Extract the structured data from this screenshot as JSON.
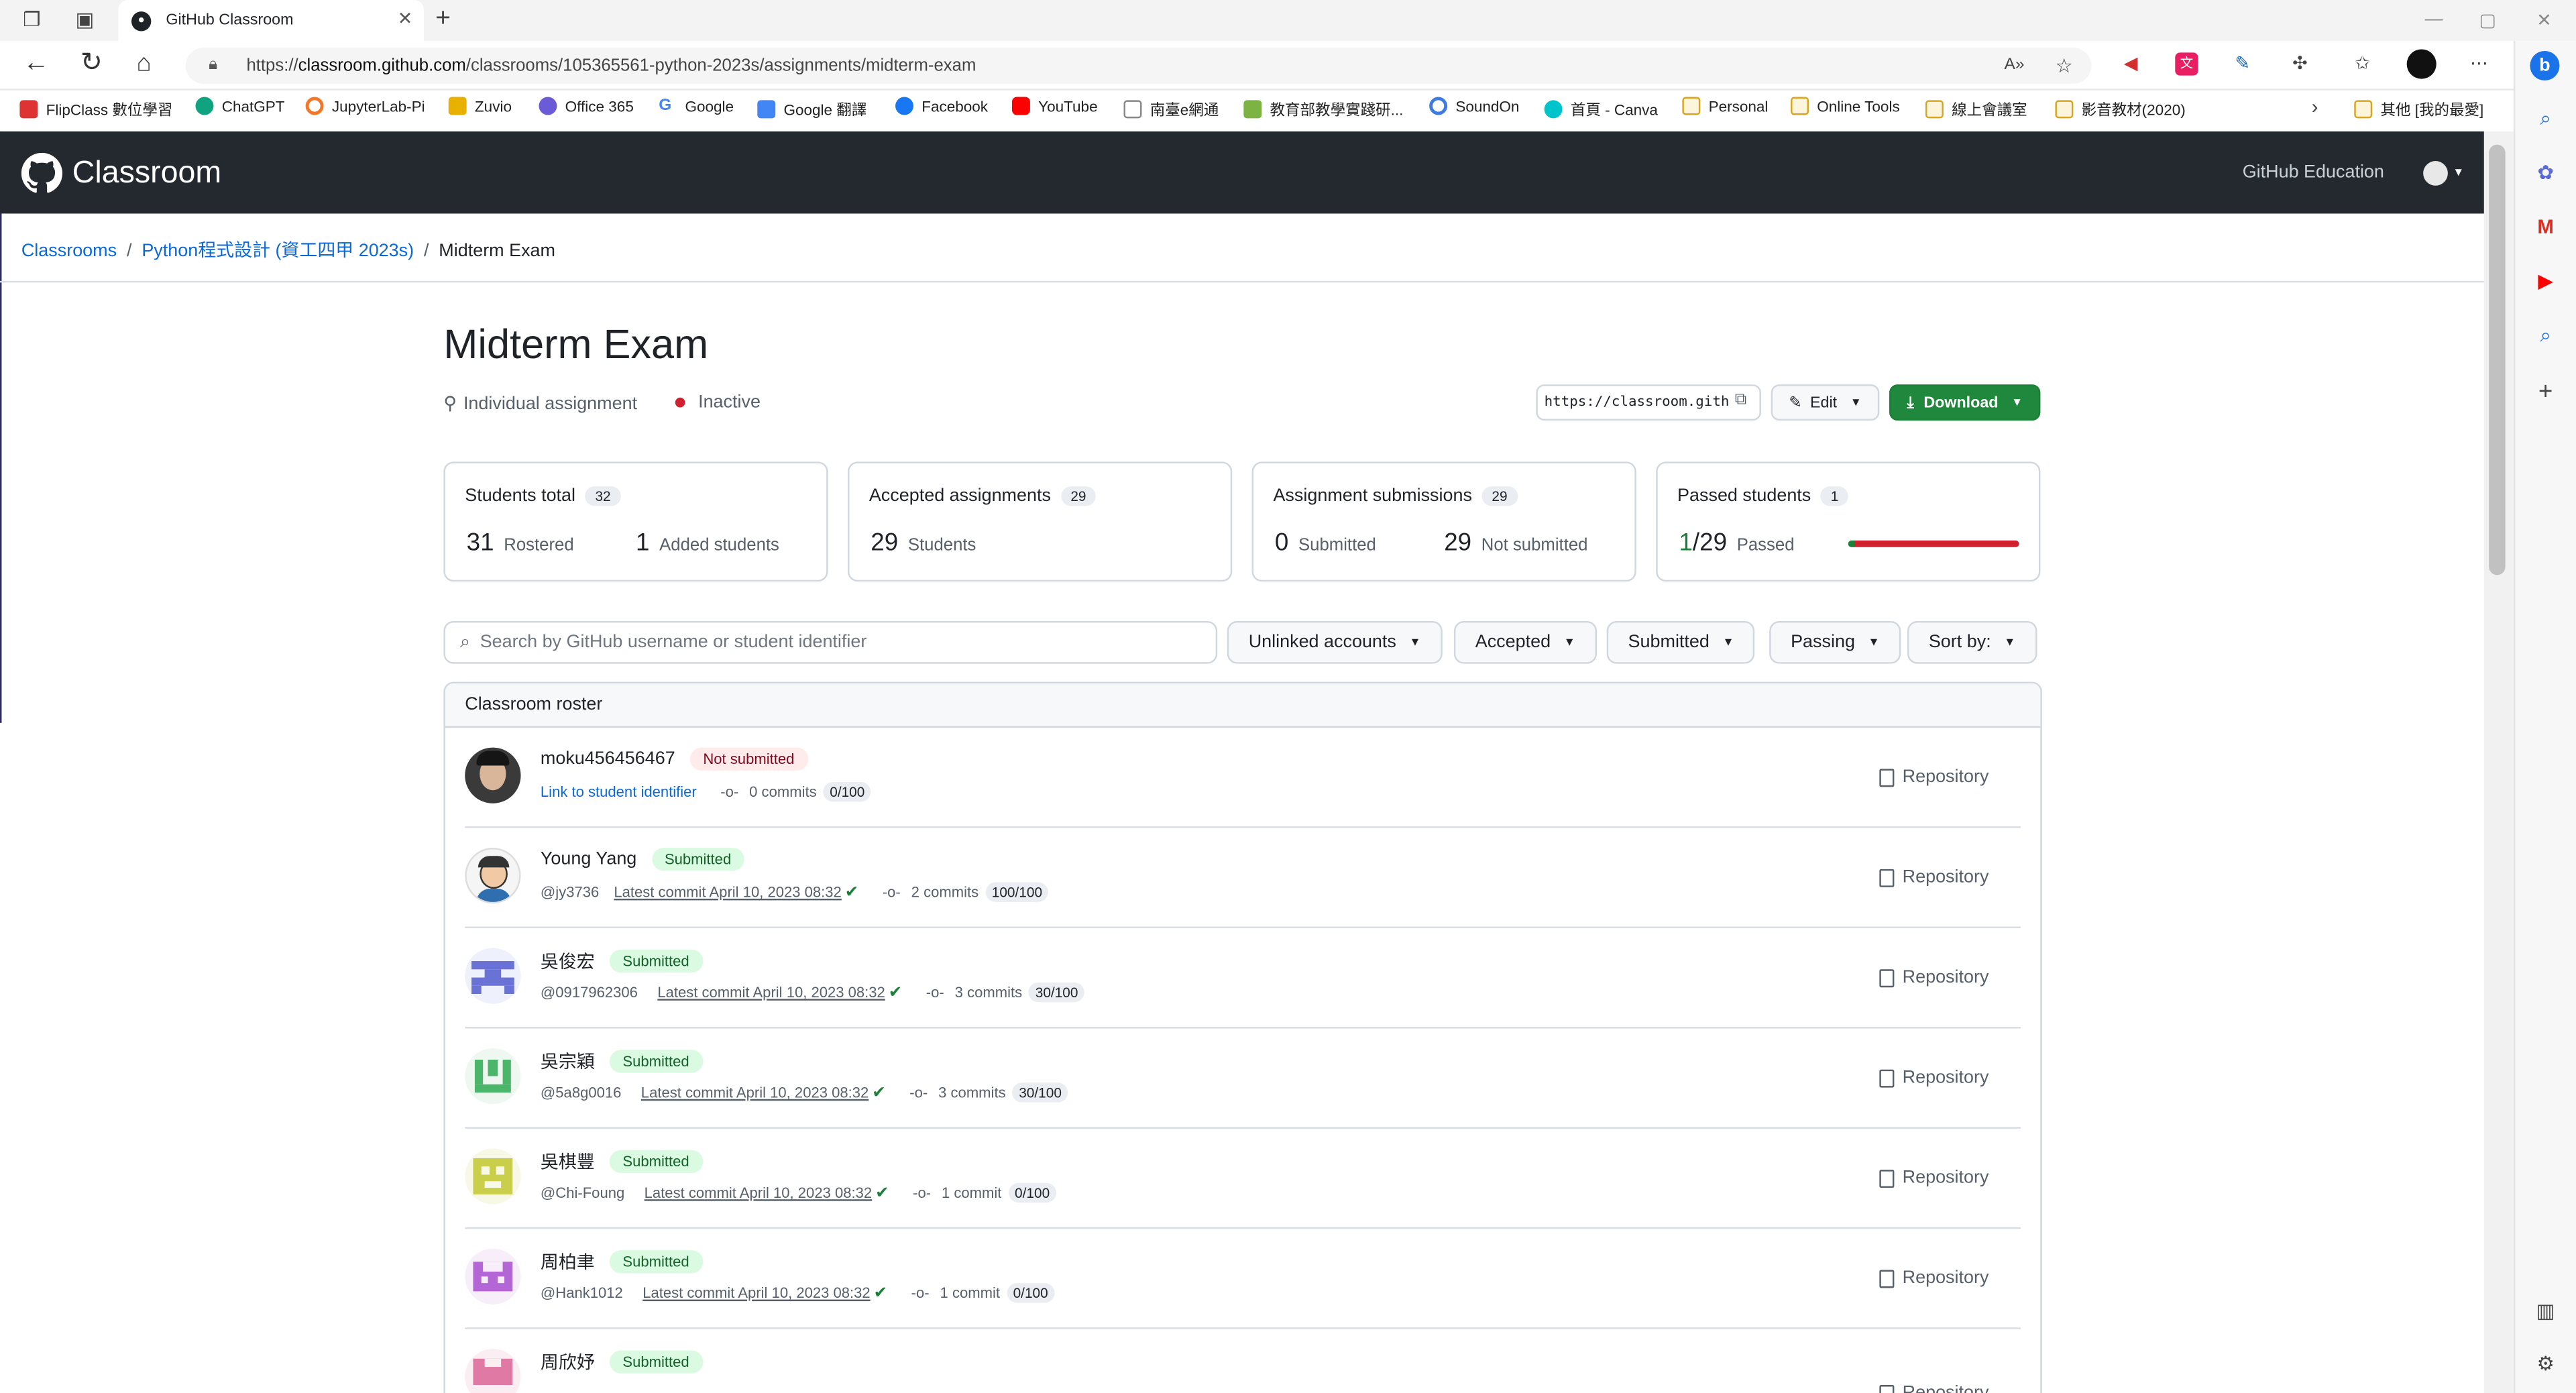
{
  "browser": {
    "tab_title": "GitHub Classroom",
    "url_prefix": "https://",
    "url_host": "classroom.github.com",
    "url_path": "/classrooms/105365561-python-2023s/assignments/midterm-exam"
  },
  "bookmarks": [
    {
      "label": "FlipClass 數位學習",
      "icon": "flipclass-icon",
      "color": "#d33"
    },
    {
      "label": "ChatGPT",
      "icon": "chatgpt-icon",
      "color": "#10a37f"
    },
    {
      "label": "JupyterLab-Pi",
      "icon": "jupyter-icon",
      "color": "#f37726"
    },
    {
      "label": "Zuvio",
      "icon": "zuvio-icon",
      "color": "#e8b000"
    },
    {
      "label": "Office 365",
      "icon": "office-icon",
      "color": "#6b5bd6"
    },
    {
      "label": "Google",
      "icon": "google-icon",
      "color": "#4285f4"
    },
    {
      "label": "Google 翻譯",
      "icon": "translate-icon",
      "color": "#4285f4"
    },
    {
      "label": "Facebook",
      "icon": "facebook-icon",
      "color": "#1877f2"
    },
    {
      "label": "YouTube",
      "icon": "youtube-icon",
      "color": "#ff0000"
    },
    {
      "label": "南臺e網通",
      "icon": "page-icon",
      "color": "#888888"
    },
    {
      "label": "教育部教學實踐研...",
      "icon": "moe-icon",
      "color": "#7cb342"
    },
    {
      "label": "SoundOn",
      "icon": "soundon-icon",
      "color": "#3d7be3"
    },
    {
      "label": "首頁 - Canva",
      "icon": "canva-icon",
      "color": "#00c4cc"
    },
    {
      "label": "Personal",
      "icon": "folder-icon",
      "color": "#d9a520"
    },
    {
      "label": "Online Tools",
      "icon": "folder-icon",
      "color": "#d9a520"
    },
    {
      "label": "線上會議室",
      "icon": "folder-icon",
      "color": "#d9a520"
    },
    {
      "label": "影音教材(2020)",
      "icon": "folder-icon",
      "color": "#d9a520"
    }
  ],
  "other_bookmarks": "其他 [我的最愛]",
  "header": {
    "brand": "Classroom",
    "link": "GitHub Education"
  },
  "breadcrumb": {
    "classrooms": "Classrooms",
    "classroom": "Python程式設計 (資工四甲 2023s)",
    "current": "Midterm Exam"
  },
  "assignment": {
    "title": "Midterm Exam",
    "type": "Individual assignment",
    "status": "Inactive",
    "invite_url": "https://classroom.github.com",
    "edit_label": "Edit",
    "download_label": "Download"
  },
  "stats": {
    "students_total": {
      "label": "Students total",
      "count": "32",
      "rostered": "31",
      "rostered_label": "Rostered",
      "added": "1",
      "added_label": "Added students"
    },
    "accepted": {
      "label": "Accepted assignments",
      "count": "29",
      "value": "29",
      "value_label": "Students"
    },
    "submissions": {
      "label": "Assignment submissions",
      "count": "29",
      "submitted": "0",
      "submitted_label": "Submitted",
      "not_submitted": "29",
      "not_submitted_label": "Not submitted"
    },
    "passed": {
      "label": "Passed students",
      "count": "1",
      "value": "1",
      "total": "/29",
      "value_label": "Passed",
      "passed_fraction": 0.0345
    }
  },
  "filters": {
    "search_placeholder": "Search by GitHub username or student identifier",
    "unlinked": "Unlinked accounts",
    "accepted": "Accepted",
    "submitted": "Submitted",
    "passing": "Passing",
    "sort": "Sort by:"
  },
  "roster": {
    "title": "Classroom roster",
    "repo_label": "Repository",
    "students": [
      {
        "name": "moku456456467",
        "status": "Not submitted",
        "link": "Link to student identifier",
        "commits": "0 commits",
        "score": "0/100"
      },
      {
        "name": "Young Yang",
        "status": "Submitted",
        "handle": "@jy3736",
        "latest": "Latest commit April 10, 2023 08:32",
        "commits": "2 commits",
        "score": "100/100"
      },
      {
        "name": "吳俊宏",
        "status": "Submitted",
        "handle": "@0917962306",
        "latest": "Latest commit April 10, 2023 08:32",
        "commits": "3 commits",
        "score": "30/100"
      },
      {
        "name": "吳宗穎",
        "status": "Submitted",
        "handle": "@5a8g0016",
        "latest": "Latest commit April 10, 2023 08:32",
        "commits": "3 commits",
        "score": "30/100"
      },
      {
        "name": "吳棋豐",
        "status": "Submitted",
        "handle": "@Chi-Foung",
        "latest": "Latest commit April 10, 2023 08:32",
        "commits": "1 commit",
        "score": "0/100"
      },
      {
        "name": "周柏聿",
        "status": "Submitted",
        "handle": "@Hank1012",
        "latest": "Latest commit April 10, 2023 08:32",
        "commits": "1 commit",
        "score": "0/100"
      },
      {
        "name": "周欣妤",
        "status": "Submitted"
      }
    ]
  }
}
